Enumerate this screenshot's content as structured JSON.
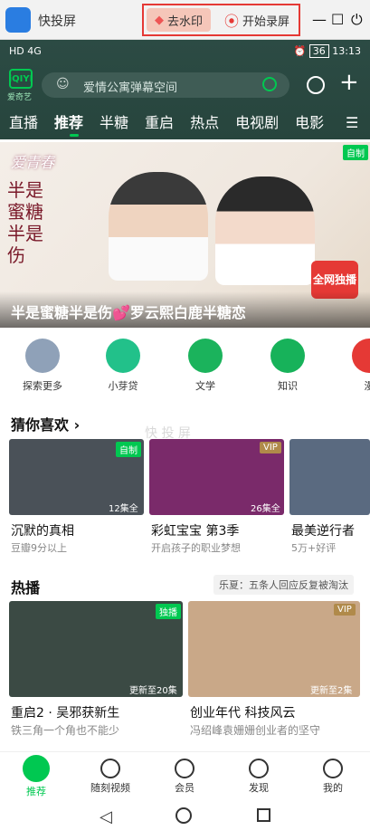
{
  "mirror": {
    "title": "快投屏",
    "remove_watermark": "去水印",
    "start_record": "开始录屏"
  },
  "status": {
    "left": "HD 4G",
    "battery": "36",
    "time": "13:13"
  },
  "header": {
    "logo": "iQIYI",
    "logo_sub": "爱奇艺",
    "search_placeholder": "爱情公寓弹幕空间"
  },
  "tabs": [
    "直播",
    "推荐",
    "半糖",
    "重启",
    "热点",
    "电视剧",
    "电影"
  ],
  "banner": {
    "badge": "自制",
    "title": "半是蜜糖半是伤💕罗云熙白鹿半糖恋",
    "tag": "全网独播",
    "calligraphy": "半是蜜糖半是伤",
    "top_text": "爱青春"
  },
  "categories": [
    {
      "label": "探索更多",
      "color": "#8fa1b8"
    },
    {
      "label": "小芽贷",
      "color": "#22c18a"
    },
    {
      "label": "文学",
      "color": "#1bb35c"
    },
    {
      "label": "知识",
      "color": "#17b25a"
    },
    {
      "label": "漫",
      "color": "#e53935"
    }
  ],
  "guess": {
    "title": "猜你喜欢 ›",
    "items": [
      {
        "title": "沉默的真相",
        "sub": "豆瓣9分以上",
        "badge": "自制",
        "eps": "12集全",
        "color": "#4a5158"
      },
      {
        "title": "彩虹宝宝 第3季",
        "sub": "开启孩子的职业梦想",
        "badge": "VIP",
        "eps": "26集全",
        "color": "#7a2a6a"
      },
      {
        "title": "最美逆行者",
        "sub": "5万+好评",
        "badge": "",
        "eps": "",
        "color": "#5a6a80"
      }
    ]
  },
  "hot": {
    "title": "热播",
    "right_text": "乐夏：五条人回应反复被淘汰",
    "items": [
      {
        "title": "重启2 · 吴邪获新生",
        "sub": "铁三角一个角也不能少",
        "badge": "独播",
        "eps": "更新至20集",
        "color": "#3b4a44"
      },
      {
        "title": "创业年代 科技风云",
        "sub": "冯绍峰袁姗姗创业者的坚守",
        "badge": "VIP",
        "eps": "更新至2集",
        "color": "#c9a888"
      }
    ]
  },
  "watermark": "快 投 屏",
  "bottom_nav": [
    "推荐",
    "随刻视频",
    "会员",
    "发现",
    "我的"
  ]
}
